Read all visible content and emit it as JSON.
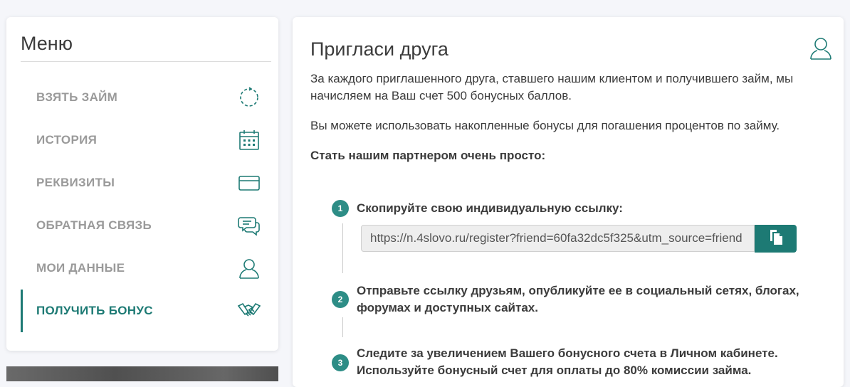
{
  "menu": {
    "title": "Меню",
    "items": [
      {
        "label": "ВЗЯТЬ ЗАЙМ",
        "icon": "refresh-icon",
        "active": false
      },
      {
        "label": "ИСТОРИЯ",
        "icon": "calendar-icon",
        "active": false
      },
      {
        "label": "РЕКВИЗИТЫ",
        "icon": "card-icon",
        "active": false
      },
      {
        "label": "ОБРАТНАЯ СВЯЗЬ",
        "icon": "chat-icon",
        "active": false
      },
      {
        "label": "МОИ ДАННЫЕ",
        "icon": "user-icon",
        "active": false
      },
      {
        "label": "ПОЛУЧИТЬ БОНУС",
        "icon": "handshake-icon",
        "active": true
      }
    ]
  },
  "main": {
    "title": "Пригласи друга",
    "intro": "За каждого приглашенного друга, ставшего нашим клиентом и получившего займ, мы начисляем на Ваш счет 500 бонусных баллов.",
    "usage": "Вы можете использовать накопленные бонусы для погашения процентов по займу.",
    "partner_heading": "Стать нашим партнером очень просто:",
    "steps": [
      {
        "num": "1",
        "text": "Скопируйте свою индивидуальную ссылку:"
      },
      {
        "num": "2",
        "text": "Отправьте ссылку друзьям, опубликуйте ее в социальный сетях, блогах, форумах и доступных сайтах."
      },
      {
        "num": "3",
        "text": "Следите за увеличением Вашего бонусного счета в Личном кабинете. Используйте бонусный счет для оплаты до 80% комиссии займа."
      }
    ],
    "referral_link": "https://n.4slovo.ru/register?friend=60fa32dc5f325&utm_source=friend"
  },
  "colors": {
    "accent": "#1d7a74",
    "step_badge": "#2d8d86",
    "muted_text": "#9a9a9a"
  }
}
